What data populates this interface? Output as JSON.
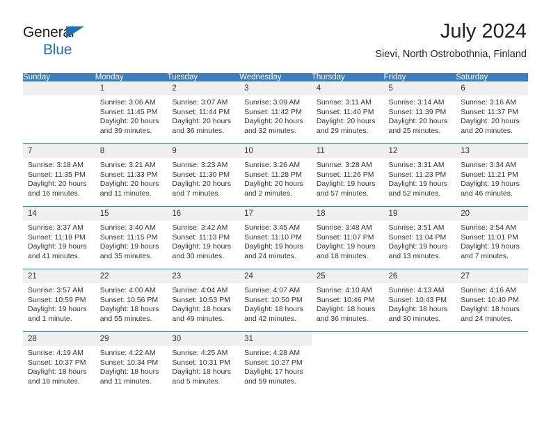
{
  "logo": {
    "word_dark": "General",
    "word_blue": "Blue",
    "shape": "triangle"
  },
  "header": {
    "title": "July 2024",
    "subtitle": "Sievi, North Ostrobothnia, Finland"
  },
  "colors": {
    "header_blue": "#3b7dc0",
    "logo_blue": "#1d72b8",
    "daynum_band": "#f0f0f0",
    "text": "#333333"
  },
  "weekday_headers": [
    "Sunday",
    "Monday",
    "Tuesday",
    "Wednesday",
    "Thursday",
    "Friday",
    "Saturday"
  ],
  "weeks": [
    [
      {
        "day": "",
        "sunrise": "",
        "sunset": "",
        "daylight": "",
        "daylight2": ""
      },
      {
        "day": "1",
        "sunrise": "Sunrise: 3:06 AM",
        "sunset": "Sunset: 11:45 PM",
        "daylight": "Daylight: 20 hours",
        "daylight2": "and 39 minutes."
      },
      {
        "day": "2",
        "sunrise": "Sunrise: 3:07 AM",
        "sunset": "Sunset: 11:44 PM",
        "daylight": "Daylight: 20 hours",
        "daylight2": "and 36 minutes."
      },
      {
        "day": "3",
        "sunrise": "Sunrise: 3:09 AM",
        "sunset": "Sunset: 11:42 PM",
        "daylight": "Daylight: 20 hours",
        "daylight2": "and 32 minutes."
      },
      {
        "day": "4",
        "sunrise": "Sunrise: 3:11 AM",
        "sunset": "Sunset: 11:40 PM",
        "daylight": "Daylight: 20 hours",
        "daylight2": "and 29 minutes."
      },
      {
        "day": "5",
        "sunrise": "Sunrise: 3:14 AM",
        "sunset": "Sunset: 11:39 PM",
        "daylight": "Daylight: 20 hours",
        "daylight2": "and 25 minutes."
      },
      {
        "day": "6",
        "sunrise": "Sunrise: 3:16 AM",
        "sunset": "Sunset: 11:37 PM",
        "daylight": "Daylight: 20 hours",
        "daylight2": "and 20 minutes."
      }
    ],
    [
      {
        "day": "7",
        "sunrise": "Sunrise: 3:18 AM",
        "sunset": "Sunset: 11:35 PM",
        "daylight": "Daylight: 20 hours",
        "daylight2": "and 16 minutes."
      },
      {
        "day": "8",
        "sunrise": "Sunrise: 3:21 AM",
        "sunset": "Sunset: 11:33 PM",
        "daylight": "Daylight: 20 hours",
        "daylight2": "and 11 minutes."
      },
      {
        "day": "9",
        "sunrise": "Sunrise: 3:23 AM",
        "sunset": "Sunset: 11:30 PM",
        "daylight": "Daylight: 20 hours",
        "daylight2": "and 7 minutes."
      },
      {
        "day": "10",
        "sunrise": "Sunrise: 3:26 AM",
        "sunset": "Sunset: 11:28 PM",
        "daylight": "Daylight: 20 hours",
        "daylight2": "and 2 minutes."
      },
      {
        "day": "11",
        "sunrise": "Sunrise: 3:28 AM",
        "sunset": "Sunset: 11:26 PM",
        "daylight": "Daylight: 19 hours",
        "daylight2": "and 57 minutes."
      },
      {
        "day": "12",
        "sunrise": "Sunrise: 3:31 AM",
        "sunset": "Sunset: 11:23 PM",
        "daylight": "Daylight: 19 hours",
        "daylight2": "and 52 minutes."
      },
      {
        "day": "13",
        "sunrise": "Sunrise: 3:34 AM",
        "sunset": "Sunset: 11:21 PM",
        "daylight": "Daylight: 19 hours",
        "daylight2": "and 46 minutes."
      }
    ],
    [
      {
        "day": "14",
        "sunrise": "Sunrise: 3:37 AM",
        "sunset": "Sunset: 11:18 PM",
        "daylight": "Daylight: 19 hours",
        "daylight2": "and 41 minutes."
      },
      {
        "day": "15",
        "sunrise": "Sunrise: 3:40 AM",
        "sunset": "Sunset: 11:15 PM",
        "daylight": "Daylight: 19 hours",
        "daylight2": "and 35 minutes."
      },
      {
        "day": "16",
        "sunrise": "Sunrise: 3:42 AM",
        "sunset": "Sunset: 11:13 PM",
        "daylight": "Daylight: 19 hours",
        "daylight2": "and 30 minutes."
      },
      {
        "day": "17",
        "sunrise": "Sunrise: 3:45 AM",
        "sunset": "Sunset: 11:10 PM",
        "daylight": "Daylight: 19 hours",
        "daylight2": "and 24 minutes."
      },
      {
        "day": "18",
        "sunrise": "Sunrise: 3:48 AM",
        "sunset": "Sunset: 11:07 PM",
        "daylight": "Daylight: 19 hours",
        "daylight2": "and 18 minutes."
      },
      {
        "day": "19",
        "sunrise": "Sunrise: 3:51 AM",
        "sunset": "Sunset: 11:04 PM",
        "daylight": "Daylight: 19 hours",
        "daylight2": "and 13 minutes."
      },
      {
        "day": "20",
        "sunrise": "Sunrise: 3:54 AM",
        "sunset": "Sunset: 11:01 PM",
        "daylight": "Daylight: 19 hours",
        "daylight2": "and 7 minutes."
      }
    ],
    [
      {
        "day": "21",
        "sunrise": "Sunrise: 3:57 AM",
        "sunset": "Sunset: 10:59 PM",
        "daylight": "Daylight: 19 hours",
        "daylight2": "and 1 minute."
      },
      {
        "day": "22",
        "sunrise": "Sunrise: 4:00 AM",
        "sunset": "Sunset: 10:56 PM",
        "daylight": "Daylight: 18 hours",
        "daylight2": "and 55 minutes."
      },
      {
        "day": "23",
        "sunrise": "Sunrise: 4:04 AM",
        "sunset": "Sunset: 10:53 PM",
        "daylight": "Daylight: 18 hours",
        "daylight2": "and 49 minutes."
      },
      {
        "day": "24",
        "sunrise": "Sunrise: 4:07 AM",
        "sunset": "Sunset: 10:50 PM",
        "daylight": "Daylight: 18 hours",
        "daylight2": "and 42 minutes."
      },
      {
        "day": "25",
        "sunrise": "Sunrise: 4:10 AM",
        "sunset": "Sunset: 10:46 PM",
        "daylight": "Daylight: 18 hours",
        "daylight2": "and 36 minutes."
      },
      {
        "day": "26",
        "sunrise": "Sunrise: 4:13 AM",
        "sunset": "Sunset: 10:43 PM",
        "daylight": "Daylight: 18 hours",
        "daylight2": "and 30 minutes."
      },
      {
        "day": "27",
        "sunrise": "Sunrise: 4:16 AM",
        "sunset": "Sunset: 10:40 PM",
        "daylight": "Daylight: 18 hours",
        "daylight2": "and 24 minutes."
      }
    ],
    [
      {
        "day": "28",
        "sunrise": "Sunrise: 4:19 AM",
        "sunset": "Sunset: 10:37 PM",
        "daylight": "Daylight: 18 hours",
        "daylight2": "and 18 minutes."
      },
      {
        "day": "29",
        "sunrise": "Sunrise: 4:22 AM",
        "sunset": "Sunset: 10:34 PM",
        "daylight": "Daylight: 18 hours",
        "daylight2": "and 11 minutes."
      },
      {
        "day": "30",
        "sunrise": "Sunrise: 4:25 AM",
        "sunset": "Sunset: 10:31 PM",
        "daylight": "Daylight: 18 hours",
        "daylight2": "and 5 minutes."
      },
      {
        "day": "31",
        "sunrise": "Sunrise: 4:28 AM",
        "sunset": "Sunset: 10:27 PM",
        "daylight": "Daylight: 17 hours",
        "daylight2": "and 59 minutes."
      },
      {
        "day": "",
        "sunrise": "",
        "sunset": "",
        "daylight": "",
        "daylight2": ""
      },
      {
        "day": "",
        "sunrise": "",
        "sunset": "",
        "daylight": "",
        "daylight2": ""
      },
      {
        "day": "",
        "sunrise": "",
        "sunset": "",
        "daylight": "",
        "daylight2": ""
      }
    ]
  ]
}
